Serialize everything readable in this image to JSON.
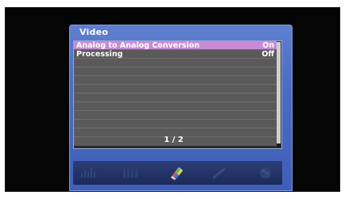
{
  "menu": {
    "title": "Video",
    "items": [
      {
        "label": "Analog to Analog Conversion",
        "value": "On",
        "selected": true
      },
      {
        "label": "Processing",
        "value": "Off",
        "selected": false
      }
    ],
    "empty_rows": 8,
    "page_indicator": "1 / 2"
  },
  "icon_bar": {
    "icons": [
      {
        "name": "audio-icon",
        "active": false
      },
      {
        "name": "speaker-icon",
        "active": false
      },
      {
        "name": "video-icon",
        "active": true
      },
      {
        "name": "tools-icon",
        "active": false
      },
      {
        "name": "globe-icon",
        "active": false
      }
    ]
  },
  "colors": {
    "osd_panel": "#4c6dc3",
    "selected_row": "#c98ad6",
    "row": "#5a5a5a",
    "icon_bar": "#1c2a58"
  }
}
